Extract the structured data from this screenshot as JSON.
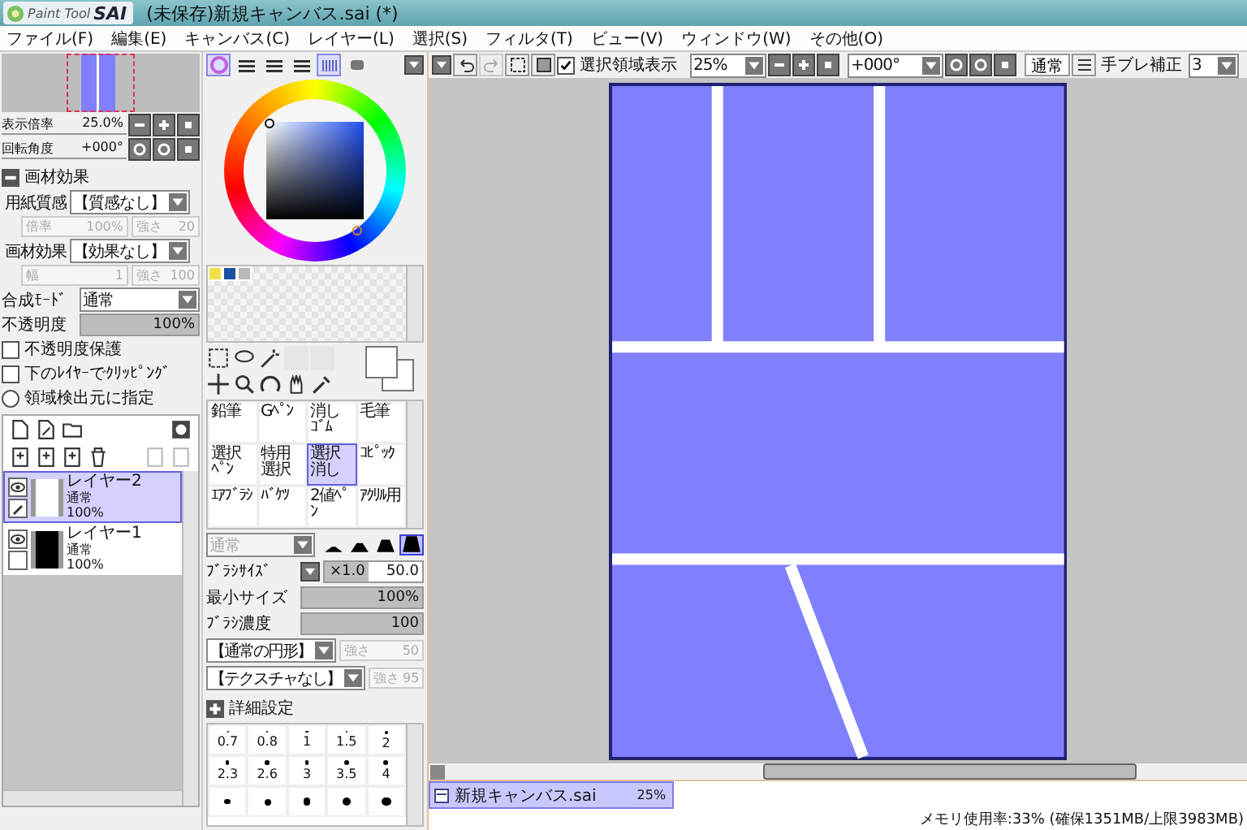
{
  "window": {
    "app_subtitle": "Paint Tool",
    "app_name": "SAI",
    "title": "(未保存)新規キャンバス.sai (*)"
  },
  "menu": [
    "ファイル(F)",
    "編集(E)",
    "キャンバス(C)",
    "レイヤー(L)",
    "選択(S)",
    "フィルタ(T)",
    "ビュー(V)",
    "ウィンドウ(W)",
    "その他(O)"
  ],
  "navigator": {
    "zoom_label": "表示倍率",
    "zoom_value": "25.0%",
    "rotation_label": "回転角度",
    "rotation_value": "+000°"
  },
  "material_effect": {
    "title": "画材効果",
    "expanded": true,
    "rows": [
      {
        "label": "用紙質感",
        "value": "【質感なし】",
        "param1_label": "倍率",
        "param1": "100%",
        "param2_label": "強さ",
        "param2": "20"
      },
      {
        "label": "画材効果",
        "value": "【効果なし】",
        "param1_label": "幅",
        "param1": "1",
        "param2_label": "強さ",
        "param2": "100"
      }
    ]
  },
  "blend": {
    "label": "合成ﾓｰﾄﾞ",
    "value": "通常"
  },
  "opacity": {
    "label": "不透明度",
    "value": "100%",
    "level": 1
  },
  "options": [
    {
      "kind": "checkbox",
      "label": "不透明度保護",
      "checked": false
    },
    {
      "kind": "checkbox",
      "label": "下のﾚｲﾔｰでｸﾘｯﾋﾟﾝｸﾞ",
      "checked": false
    },
    {
      "kind": "radio",
      "label": "領域検出元に指定",
      "checked": false
    }
  ],
  "layers": [
    {
      "name": "レイヤー2",
      "mode": "通常",
      "opacity": "100%",
      "selected": true,
      "visible": true,
      "color": "#ffffff"
    },
    {
      "name": "レイヤー1",
      "mode": "通常",
      "opacity": "100%",
      "selected": false,
      "visible": true,
      "color": "#000000"
    }
  ],
  "color_tabs": [
    {
      "on": true
    },
    {
      "on": false
    },
    {
      "on": false
    },
    {
      "on": false
    },
    {
      "on": true
    },
    {
      "on": false
    }
  ],
  "swatches": [
    {
      "color": "#f0e04c"
    },
    {
      "color": "#1c50a0"
    },
    {
      "color": "#b8b8b8"
    }
  ],
  "brushes": [
    {
      "label": "鉛筆",
      "selected": false
    },
    {
      "label": "Gﾍﾟﾝ",
      "selected": false
    },
    {
      "label": "消しｺﾞﾑ",
      "selected": false
    },
    {
      "label": "毛筆",
      "selected": false
    },
    {
      "label": "選択ﾍﾟﾝ",
      "selected": false
    },
    {
      "label": "特用選択",
      "selected": false
    },
    {
      "label": "選択消し",
      "selected": true
    },
    {
      "label": "ｺﾋﾟｯｸ",
      "selected": false
    },
    {
      "label": "ｴｱﾌﾞﾗｼ",
      "selected": false
    },
    {
      "label": "ﾊﾞｹﾂ",
      "selected": false
    },
    {
      "label": "2値ﾍﾟﾝ",
      "selected": false
    },
    {
      "label": "ｱｸﾘﾙ用",
      "selected": false
    }
  ],
  "brush_mode": "通常",
  "tips": [
    {
      "selected": false
    },
    {
      "selected": false
    },
    {
      "selected": false
    },
    {
      "selected": true
    }
  ],
  "sliders": [
    {
      "label": "ﾌﾞﾗｼｻｲｽﾞ",
      "multiplier": "×1.0",
      "value": "50.0",
      "level": 0.45
    },
    {
      "label": "最小サイズ",
      "value": "100%",
      "level": 1
    },
    {
      "label": "ﾌﾞﾗｼ濃度",
      "value": "100",
      "level": 1
    }
  ],
  "shapes": [
    {
      "value": "【通常の円形】",
      "param_label": "強さ",
      "param": "50"
    },
    {
      "value": "【テクスチャなし】",
      "param_label": "強さ",
      "param": "95"
    }
  ],
  "detail": {
    "label": "詳細設定",
    "expanded": false
  },
  "size_presets": [
    "0.7",
    "0.8",
    "1",
    "1.5",
    "2",
    "2.3",
    "2.6",
    "3",
    "3.5",
    "4"
  ],
  "toolbar": {
    "selection_label": "選択領域表示",
    "selection_checked": true,
    "zoom": "25%",
    "rotation": "+000°",
    "mode": "通常",
    "stabilizer_label": "手ブレ補正",
    "stabilizer": "3"
  },
  "canvas_tabs": [
    {
      "name": "新規キャンバス.sai",
      "zoom": "25%",
      "selected": true
    }
  ],
  "status": "メモリ使用率:33% (確保1351MB/上限3983MB)"
}
